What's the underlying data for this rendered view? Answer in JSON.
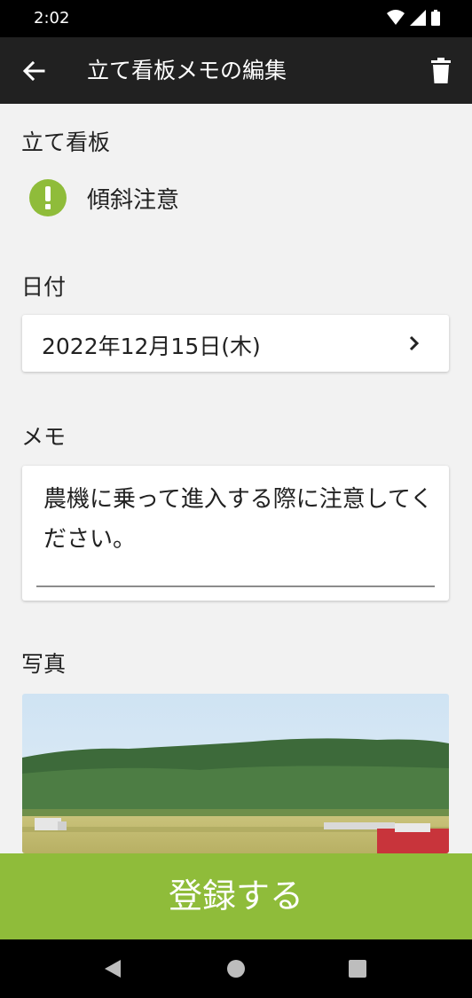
{
  "status_bar": {
    "time": "2:02"
  },
  "app_bar": {
    "title": "立て看板メモの編集"
  },
  "sign": {
    "label": "立て看板",
    "name": "傾斜注意",
    "icon": "alert-icon"
  },
  "date": {
    "label": "日付",
    "value": "2022年12月15日(木)"
  },
  "memo": {
    "label": "メモ",
    "text": "農機に乗って進入する際に注意してください。"
  },
  "photo": {
    "label": "写真"
  },
  "register_button": {
    "label": "登録する"
  },
  "colors": {
    "accent": "#8fbc3a",
    "app_bar": "#212121",
    "background": "#f2f2f2"
  }
}
